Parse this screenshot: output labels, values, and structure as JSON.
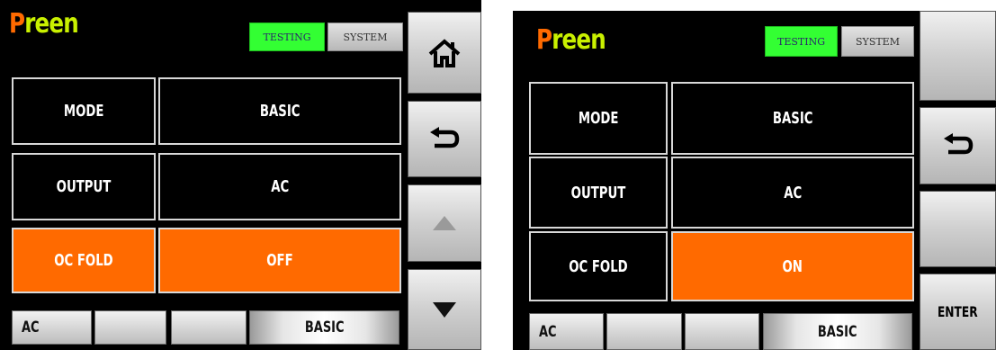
{
  "screens": [
    {
      "logo": {
        "first": "P",
        "rest": "reen"
      },
      "tabs": {
        "testing": "TESTING",
        "system": "SYSTEM"
      },
      "rows": [
        {
          "label": "MODE",
          "value": "BASIC"
        },
        {
          "label": "OUTPUT",
          "value": "AC"
        },
        {
          "label": "OC FOLD",
          "value": "OFF"
        }
      ],
      "side_icons": [
        "home-icon",
        "back-arrow-icon",
        "up-arrow-icon",
        "down-arrow-icon"
      ],
      "bottom": {
        "ac": "AC",
        "basic": "BASIC"
      }
    },
    {
      "logo": {
        "first": "P",
        "rest": "reen"
      },
      "tabs": {
        "testing": "TESTING",
        "system": "SYSTEM"
      },
      "rows": [
        {
          "label": "MODE",
          "value": "BASIC"
        },
        {
          "label": "OUTPUT",
          "value": "AC"
        },
        {
          "label": "OC FOLD",
          "value": "ON"
        }
      ],
      "side_icons": [
        "back-arrow-icon"
      ],
      "side": {
        "enter": "ENTER"
      },
      "bottom": {
        "ac": "AC",
        "basic": "BASIC"
      }
    }
  ],
  "colors": {
    "logo_p": "#ff6a00",
    "logo_rest": "#c9f000",
    "selected": "#ff6a00",
    "tab_active": "#33ff33"
  }
}
